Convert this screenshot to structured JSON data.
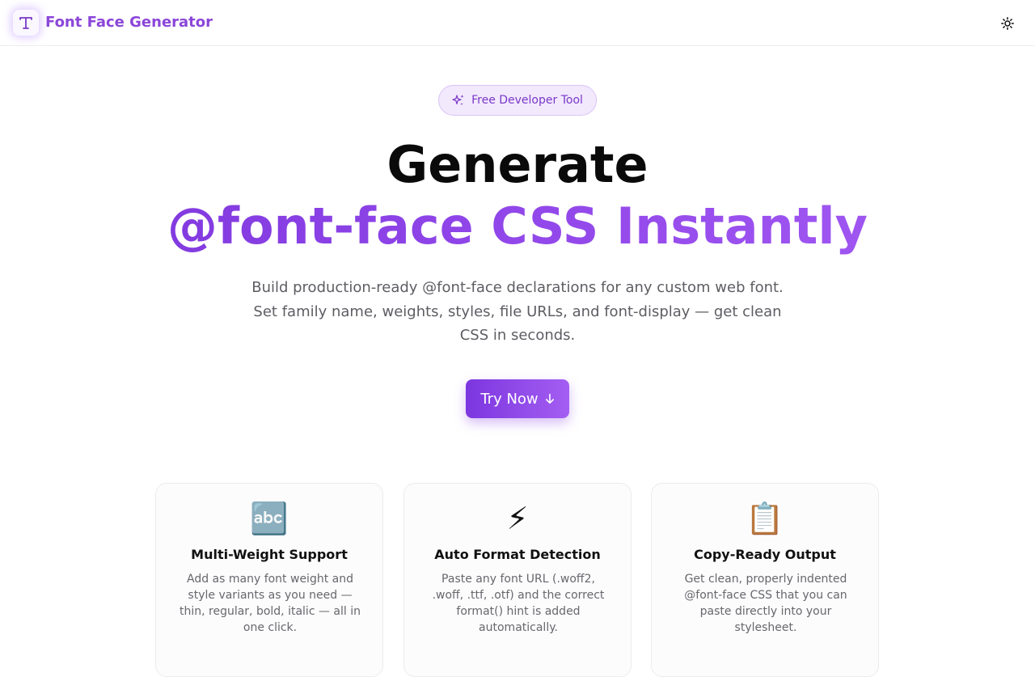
{
  "header": {
    "logo_letter": "T",
    "brand": "Font Face Generator",
    "theme_icon": "sun-icon",
    "brand_color": "#8b46d9"
  },
  "hero": {
    "badge_icon": "sparkles-icon",
    "badge": "Free Developer Tool",
    "title_line1": "Generate",
    "title_line2": "@font-face CSS Instantly",
    "description": "Build production-ready @font-face declarations for any custom web font. Set family name, weights, styles, file URLs, and font-display — get clean CSS in seconds.",
    "cta_label": "Try Now",
    "cta_icon": "arrow-down-icon",
    "accent": "#8b46e8"
  },
  "features": [
    {
      "icon": "abc-icon",
      "emoji": "🔤",
      "title": "Multi-Weight Support",
      "description": "Add as many font weight and style variants as you need — thin, regular, bold, italic — all in one click."
    },
    {
      "icon": "lightning-icon",
      "emoji": "⚡",
      "title": "Auto Format Detection",
      "description": "Paste any font URL (.woff2, .woff, .ttf, .otf) and the correct format() hint is added automatically."
    },
    {
      "icon": "clipboard-icon",
      "emoji": "📋",
      "title": "Copy-Ready Output",
      "description": "Get clean, properly indented @font-face CSS that you can paste directly into your stylesheet."
    }
  ]
}
